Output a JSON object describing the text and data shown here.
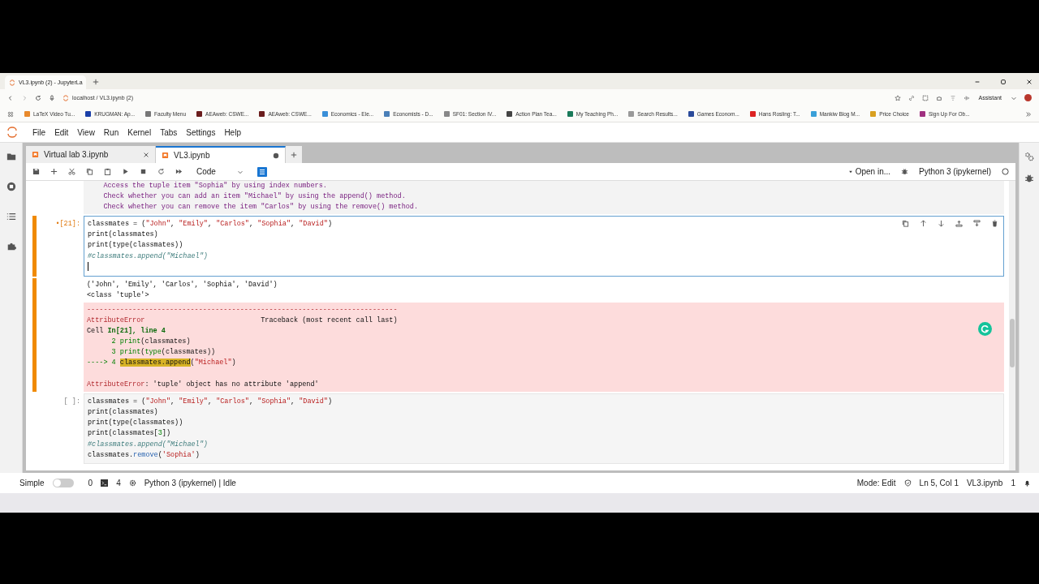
{
  "browser": {
    "tab_title": "VL3.ipynb (2) - JupyterLa",
    "url": "localhost / VL3.ipynb (2)",
    "assistant": "Assistant",
    "bookmarks": [
      "LaTeX Video Tu...",
      "KRUGMAN: Ap...",
      "Faculty Menu",
      "AEAweb: CSWE...",
      "AEAweb: CSWE...",
      "Economics - Ele...",
      "Economists - D...",
      "SF01: Section IV...",
      "Action Plan Tea...",
      "My Teaching Ph...",
      "Search Results...",
      "Games Econom...",
      "Hans Rosling: T...",
      "Mankiw Blog M...",
      "Price Choice",
      "Sign Up For Ob..."
    ]
  },
  "menu": [
    "File",
    "Edit",
    "View",
    "Run",
    "Kernel",
    "Tabs",
    "Settings",
    "Help"
  ],
  "tabs": [
    {
      "label": "Virtual lab 3.ipynb",
      "selected": false,
      "unsaved": false
    },
    {
      "label": "VL3.ipynb",
      "selected": true,
      "unsaved": true
    }
  ],
  "toolbar": {
    "cell_type": "Code",
    "open_in": "Open in...",
    "kernel": "Python 3 (ipykernel)"
  },
  "cells": [
    {
      "kind": "markdown",
      "active": false,
      "lines": [
        [
          {
            "kind": "md",
            "text": "    Access the tuple item \"Sophia\" by using index numbers."
          }
        ],
        [
          {
            "kind": "md",
            "text": "    Check whether you can add an item \"Michael\" by using the append() method."
          }
        ],
        [
          {
            "kind": "md",
            "text": "    Check whether you can remove the item \"Carlos\" by using the remove() method."
          }
        ]
      ]
    },
    {
      "kind": "code",
      "active": true,
      "prompt": "•[21]:",
      "lines": [
        [
          {
            "kind": "plain",
            "text": "classmates = ("
          },
          {
            "kind": "str",
            "text": "\"John\""
          },
          {
            "kind": "plain",
            "text": ", "
          },
          {
            "kind": "str",
            "text": "\"Emily\""
          },
          {
            "kind": "plain",
            "text": ", "
          },
          {
            "kind": "str",
            "text": "\"Carlos\""
          },
          {
            "kind": "plain",
            "text": ", "
          },
          {
            "kind": "str",
            "text": "\"Sophia\""
          },
          {
            "kind": "plain",
            "text": ", "
          },
          {
            "kind": "str",
            "text": "\"David\""
          },
          {
            "kind": "plain",
            "text": ")"
          }
        ],
        [
          {
            "kind": "plain",
            "text": "print(classmates)"
          }
        ],
        [
          {
            "kind": "plain",
            "text": "print(type(classmates))"
          }
        ],
        [
          {
            "kind": "comment",
            "text": "#classmates.append(\"Michael\")"
          }
        ]
      ],
      "outputs": [
        {
          "kind": "stdout",
          "lines": [
            [
              {
                "kind": "plain",
                "text": "('John', 'Emily', 'Carlos', 'Sophia', 'David')"
              }
            ],
            [
              {
                "kind": "plain",
                "text": "<class 'tuple'>"
              }
            ]
          ]
        },
        {
          "kind": "error",
          "lines": [
            [
              {
                "kind": "err",
                "text": "---------------------------------------------------------------------------"
              }
            ],
            [
              {
                "kind": "err",
                "text": "AttributeError"
              },
              {
                "kind": "plain",
                "text": "                            Traceback (most recent call last)"
              }
            ],
            [
              {
                "kind": "plain",
                "text": "Cell "
              },
              {
                "kind": "loc",
                "text": "In[21], line 4"
              }
            ],
            [
              {
                "kind": "fn",
                "text": "      2 print"
              },
              {
                "kind": "plain",
                "text": "(classmates)"
              }
            ],
            [
              {
                "kind": "fn",
                "text": "      3 print"
              },
              {
                "kind": "plain",
                "text": "("
              },
              {
                "kind": "fn",
                "text": "type"
              },
              {
                "kind": "plain",
                "text": "(classmates))"
              }
            ],
            [
              {
                "kind": "fn",
                "text": "----> 4 "
              },
              {
                "kind": "hl",
                "text": "classmates.append"
              },
              {
                "kind": "plain",
                "text": "("
              },
              {
                "kind": "str",
                "text": "\"Michael\""
              },
              {
                "kind": "plain",
                "text": ")"
              }
            ],
            [
              {
                "kind": "err",
                "text": "AttributeError"
              },
              {
                "kind": "plain",
                "text": ": 'tuple' object has no attribute 'append'"
              }
            ]
          ]
        }
      ]
    },
    {
      "kind": "code",
      "active": false,
      "prompt": "[ ]:",
      "lines": [
        [
          {
            "kind": "plain",
            "text": "classmates = ("
          },
          {
            "kind": "str",
            "text": "\"John\""
          },
          {
            "kind": "plain",
            "text": ", "
          },
          {
            "kind": "str",
            "text": "\"Emily\""
          },
          {
            "kind": "plain",
            "text": ", "
          },
          {
            "kind": "str",
            "text": "\"Carlos\""
          },
          {
            "kind": "plain",
            "text": ", "
          },
          {
            "kind": "str",
            "text": "\"Sophia\""
          },
          {
            "kind": "plain",
            "text": ", "
          },
          {
            "kind": "str",
            "text": "\"David\""
          },
          {
            "kind": "plain",
            "text": ")"
          }
        ],
        [
          {
            "kind": "plain",
            "text": "print(classmates)"
          }
        ],
        [
          {
            "kind": "plain",
            "text": "print(type(classmates))"
          }
        ],
        [
          {
            "kind": "plain",
            "text": "print(classmates["
          },
          {
            "kind": "num",
            "text": "3"
          },
          {
            "kind": "plain",
            "text": "])"
          }
        ],
        [
          {
            "kind": "comment",
            "text": "#classmates.append(\"Michael\")"
          }
        ],
        [
          {
            "kind": "plain",
            "text": "classmates."
          },
          {
            "kind": "prop",
            "text": "remove"
          },
          {
            "kind": "plain",
            "text": "("
          },
          {
            "kind": "str",
            "text": "'Sophia'"
          },
          {
            "kind": "plain",
            "text": ")"
          }
        ]
      ]
    }
  ],
  "status_bar": {
    "mode_label": "Simple",
    "simple_mode": false,
    "terminals": "0",
    "kernels": "4",
    "kernel_status": "Python 3 (ipykernel) | Idle",
    "mode": "Mode: Edit",
    "cursor": "Ln 5, Col 1",
    "file": "VL3.ipynb",
    "notifications": "1"
  }
}
